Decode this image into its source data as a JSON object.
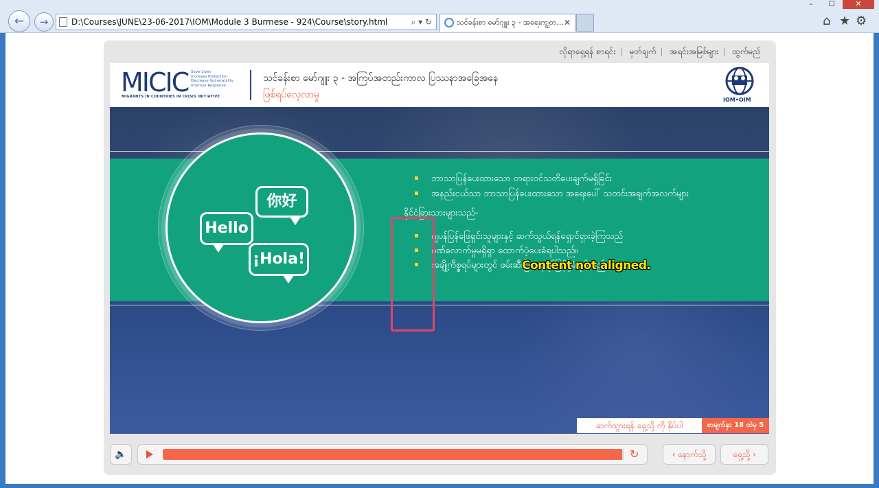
{
  "window": {
    "min": "–",
    "max": "☐",
    "close": "✕"
  },
  "browser": {
    "back_icon": "back-arrow-icon",
    "back_glyph": "←",
    "forward_glyph": "→",
    "address": "D:\\Courses\\JUNE\\23-06-2017\\IOM\\Module 3 Burmese - 924\\Course\\story.html",
    "address_tools": "⌕ ▾ ↻",
    "tab_title": "သင်ခန်းစာ မော်ဂျူး ၃ - အရေးကျွတ...",
    "tab_close": "✕",
    "home": "⌂",
    "star": "★",
    "gear": "⚙"
  },
  "topmenu": [
    "လိုရာရှေ့ရန် စာရင်း",
    "မှတ်ချက်",
    "အရင်းအမြစ်များ",
    "ထွက်မည်"
  ],
  "header": {
    "logo": "MICIC",
    "logo_tagline": "Save Lives\nIncrease Protection\nDecrease Vulnerability\nImprove Response",
    "logo_sub": "MIGRANTS IN COUNTRIES IN CRISIS INITIATIVE",
    "title": "သင်ခန်းစာ မော်ဂျူး ၃ - အကြပ်အတည်းကာလ ပြဿနာအခြေအနေ",
    "subtitle": "ဖြစ်ရပ်လေ့လာမှု",
    "iom_label": "IOM•OIM"
  },
  "bubbles": {
    "hello": "Hello",
    "nihao": "你好",
    "hola": "¡Hola!"
  },
  "content": {
    "bullets_top": [
      "ဘာသာပြန်ပေးထားသော တရားဝင်သတိပေးချက်မရှိခြင်း",
      "အနည်းငယ်သာ ဘာသာပြန်ပေးထားသော အရေးပေါ် သတင်းအချက်အလက်များ"
    ],
    "intro": "နိုင်ငံခြားသားများသည်-",
    "bullets_bottom": [
      "ဂျပန်ပြန်ဖြေရှင်းသူများနှင့် ဆက်သွယ်ရန်ရှောင်ရှားခဲ့ကြသည်",
      "ဂုဏ်လောက်မှုမရှိရှာ ထောက်ပံ့ပေးခံရပါသည်။",
      "အချို့ကိစ္စရပ်များတွင် ဖမ်းဆီးပြီး နေရပ်ပြန်ပို့ခံရပါသည်။"
    ]
  },
  "annotation": "Content not aligned.",
  "footer": {
    "hint": "ဆက်သွားရန် ရှေ့သို့ ကို နှိပ်ပါ",
    "page": "စာမျက်နှာ 18 ထဲမှ 5"
  },
  "controls": {
    "audio_icon": "🔈",
    "replay_icon": "↻",
    "progress_fraction": 0.995,
    "prev": "‹ နောက်သို့",
    "next": "ရှေ့သို့ ›"
  }
}
